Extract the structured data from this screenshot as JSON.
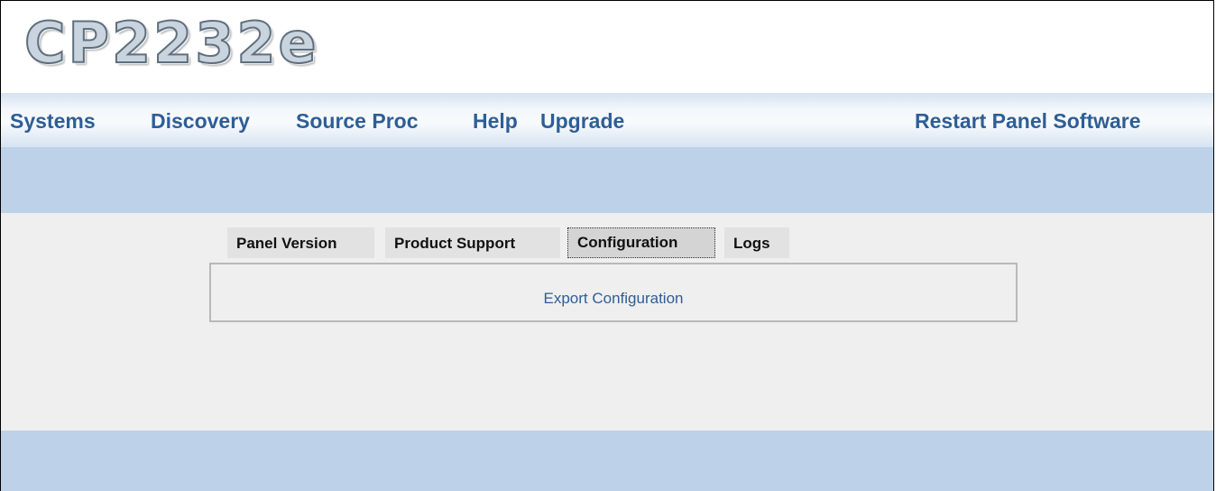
{
  "header": {
    "logo_text": "CP2232e"
  },
  "nav": {
    "items": [
      {
        "label": "Systems"
      },
      {
        "label": "Discovery"
      },
      {
        "label": "Source Proc"
      },
      {
        "label": "Help"
      },
      {
        "label": "Upgrade"
      }
    ],
    "restart_label": "Restart Panel Software"
  },
  "tabs": [
    {
      "label": "Panel Version",
      "active": false
    },
    {
      "label": "Product Support",
      "active": false
    },
    {
      "label": "Configuration",
      "active": true
    },
    {
      "label": "Logs",
      "active": false
    }
  ],
  "panel": {
    "export_label": "Export Configuration"
  },
  "colors": {
    "nav_text": "#2e5e96",
    "band": "#bdd1e8",
    "content_bg": "#efefef"
  }
}
